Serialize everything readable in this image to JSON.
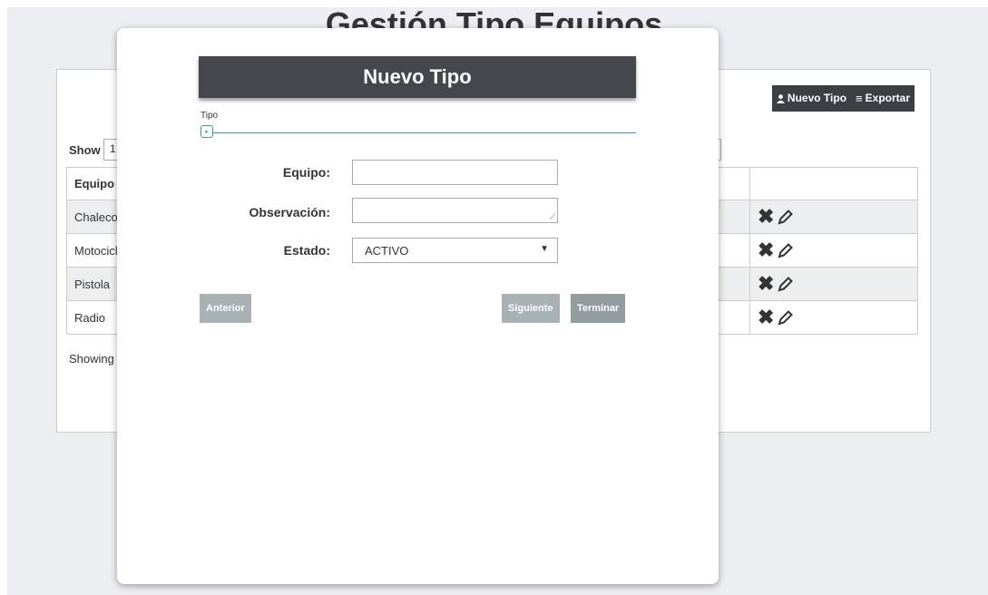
{
  "page": {
    "title": "Gestión Tipo Equipos"
  },
  "toolbar": {
    "new_label": "Nuevo Tipo",
    "export_label": "Exportar",
    "new_icon": "user-icon",
    "export_icon": "list-icon"
  },
  "table": {
    "show_label": "Show",
    "show_value": "1",
    "header_equipo": "Equipo",
    "rows": [
      "Chaleco",
      "Motocicl",
      "Pistola",
      "Radio"
    ],
    "showing": "Showing"
  },
  "modal": {
    "title": "Nuevo Tipo",
    "step_label": "Tipo",
    "equipo_label": "Equipo:",
    "observacion_label": "Observación:",
    "estado_label": "Estado:",
    "estado_value": "ACTIVO",
    "prev_label": "Anterior",
    "next_label": "Siguiente",
    "finish_label": "Terminar"
  },
  "colors": {
    "dark_button": "#3c3f44",
    "modal_header": "#44474c",
    "step_accent": "#3a9b96",
    "disabled_button": "#a8b1b3"
  }
}
